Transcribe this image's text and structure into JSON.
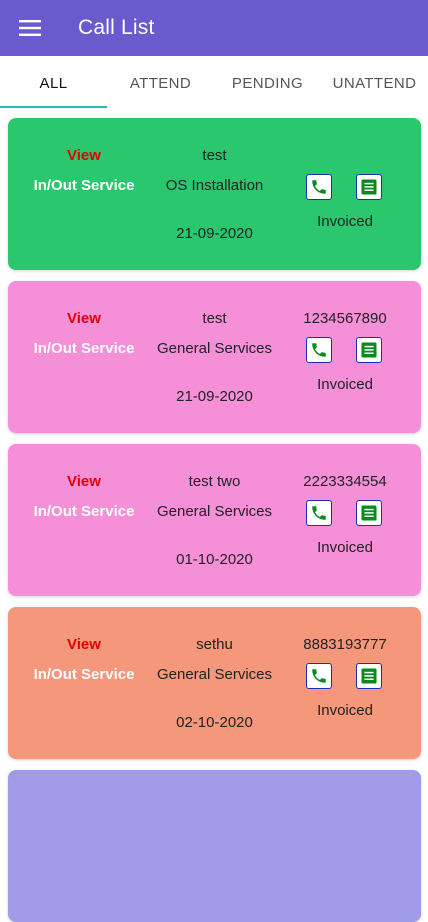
{
  "appbar": {
    "title": "Call List",
    "menu_icon": "menu-icon",
    "color": "#6a5acd"
  },
  "tabs": [
    {
      "label": "ALL",
      "active": true
    },
    {
      "label": "ATTEND",
      "active": false
    },
    {
      "label": "PENDING",
      "active": false
    },
    {
      "label": "UNATTEND",
      "active": false
    }
  ],
  "tab_indicator_color": "#2bb3c0",
  "calls": [
    {
      "view_label": "View",
      "service_type": "In/Out Service",
      "customer": "test",
      "service": "OS Installation",
      "date": "21-09-2020",
      "phone": "",
      "status": "Invoiced",
      "card_color": "#2ac76e"
    },
    {
      "view_label": "View",
      "service_type": "In/Out Service",
      "customer": "test",
      "service": "General Services",
      "date": "21-09-2020",
      "phone": "1234567890",
      "status": "Invoiced",
      "card_color": "#f48fd8"
    },
    {
      "view_label": "View",
      "service_type": "In/Out Service",
      "customer": "test two",
      "service": "General Services",
      "date": "01-10-2020",
      "phone": "2223334554",
      "status": "Invoiced",
      "card_color": "#f48fd8"
    },
    {
      "view_label": "View",
      "service_type": "In/Out Service",
      "customer": "sethu",
      "service": "General Services",
      "date": "02-10-2020",
      "phone": "8883193777",
      "status": "Invoiced",
      "card_color": "#f4977a"
    },
    {
      "view_label": "",
      "service_type": "",
      "customer": "",
      "service": "",
      "date": "",
      "phone": "",
      "status": "",
      "card_color": "#a09be6"
    }
  ],
  "icons": {
    "call": "phone-icon",
    "invoice": "invoice-icon"
  }
}
